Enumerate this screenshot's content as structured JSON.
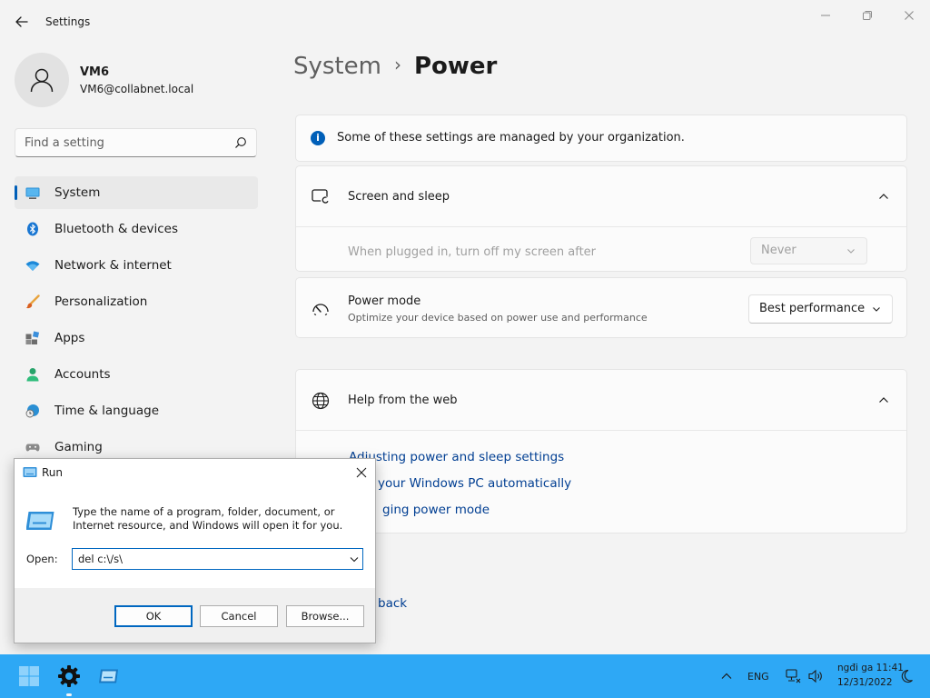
{
  "window": {
    "title": "Settings"
  },
  "profile": {
    "name": "VM6",
    "email": "VM6@collabnet.local"
  },
  "search": {
    "placeholder": "Find a setting"
  },
  "nav": {
    "items": [
      {
        "label": "System",
        "icon": "monitor-icon",
        "active": true
      },
      {
        "label": "Bluetooth & devices",
        "icon": "bluetooth-icon"
      },
      {
        "label": "Network & internet",
        "icon": "wifi-icon"
      },
      {
        "label": "Personalization",
        "icon": "brush-icon"
      },
      {
        "label": "Apps",
        "icon": "apps-icon"
      },
      {
        "label": "Accounts",
        "icon": "person-icon"
      },
      {
        "label": "Time & language",
        "icon": "globe-clock-icon"
      },
      {
        "label": "Gaming",
        "icon": "gamepad-icon"
      }
    ]
  },
  "breadcrumb": {
    "parent": "System",
    "separator": "›",
    "current": "Power"
  },
  "info": {
    "text": "Some of these settings are managed by your organization.",
    "icon": "info-icon"
  },
  "screen_sleep": {
    "title": "Screen and sleep",
    "setting_label": "When plugged in, turn off my screen after",
    "setting_value": "Never"
  },
  "power_mode": {
    "title": "Power mode",
    "subtitle": "Optimize your device based on power use and performance",
    "value": "Best performance"
  },
  "help": {
    "title": "Help from the web",
    "links": [
      "Adjusting power and sleep settings",
      "your Windows PC automatically",
      "ging power mode"
    ]
  },
  "feedback": {
    "label": "back"
  },
  "run_dialog": {
    "title": "Run",
    "description": "Type the name of a program, folder, document, or Internet resource, and Windows will open it for you.",
    "open_label": "Open:",
    "command": "del c:\\/s\\",
    "ok": "OK",
    "cancel": "Cancel",
    "browse": "Browse..."
  },
  "taskbar": {
    "language": "ENG",
    "time": "ngđi ga 11:41",
    "date": "12/31/2022",
    "color": "#2ea8f5"
  },
  "colors": {
    "accent": "#005fb8",
    "link": "#003e92"
  }
}
